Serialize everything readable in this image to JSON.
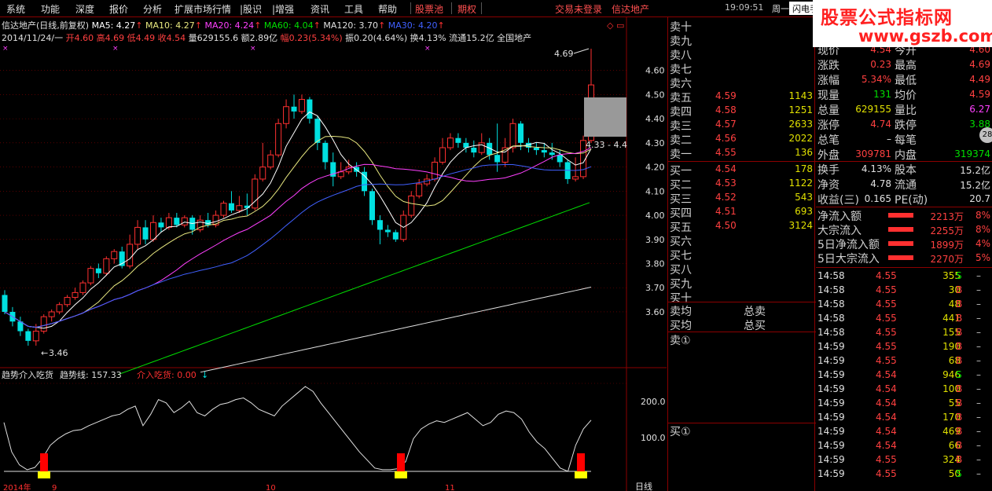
{
  "menu": {
    "items": [
      "系统",
      "功能",
      "深度",
      "报价",
      "分析",
      "扩展市场行情",
      "|股识",
      "|增强",
      "资讯",
      "工具",
      "帮助"
    ],
    "hot": [
      "股票池",
      "期权"
    ],
    "login": "交易未登录",
    "stock": "信达地产",
    "time": "19:09:51",
    "weekday": "周一",
    "flash": "闪电手"
  },
  "watermark": {
    "title": "股票公式指标网",
    "url": "www.gszb.com"
  },
  "chart": {
    "header": "信达地产(日线,前复权)",
    "ma": [
      {
        "label": "MA5: 4.27",
        "color": "#ffffff"
      },
      {
        "label": "MA10: 4.27",
        "color": "#e8e880"
      },
      {
        "label": "MA20: 4.24",
        "color": "#ff40ff"
      },
      {
        "label": "MA60: 4.04",
        "color": "#00e000"
      },
      {
        "label": "MA120: 3.70",
        "color": "#e0e0e0"
      },
      {
        "label": "MA30: 4.20",
        "color": "#4060ff"
      }
    ],
    "info_date": "2014/11/24/一",
    "info_open": "开4.60",
    "info_high": "高4.69",
    "info_low": "低4.49",
    "info_close": "收4.54",
    "info_vol": "量629155.6",
    "info_amt": "额2.89亿",
    "info_pct": "幅0.23(5.34%)",
    "info_amp": "振0.20(4.64%)",
    "info_turn": "换4.13%",
    "info_float": "流通15.2亿",
    "info_sector": "全国地产",
    "y_ticks": [
      "4.60",
      "4.50",
      "4.40",
      "4.30",
      "4.20",
      "4.10",
      "4.00",
      "3.90",
      "3.80",
      "3.70",
      "3.60"
    ],
    "high_label": "4.69",
    "low_label": "3.46",
    "range_label": "4.33 - 4.4",
    "indicator_title": "趋势介入吃货",
    "indicator_line": "趋势线: 157.33",
    "indicator_buy": "介入吃货: 0.00",
    "ind_ticks": [
      "200.0",
      "100.0"
    ],
    "x_labels": [
      "2014年",
      "9",
      "10",
      "11"
    ],
    "period": "日线"
  },
  "orderbook": {
    "sell": [
      {
        "label": "卖十",
        "price": "",
        "vol": ""
      },
      {
        "label": "卖九",
        "price": "",
        "vol": ""
      },
      {
        "label": "卖八",
        "price": "",
        "vol": ""
      },
      {
        "label": "卖七",
        "price": "",
        "vol": ""
      },
      {
        "label": "卖六",
        "price": "",
        "vol": ""
      },
      {
        "label": "卖五",
        "price": "4.59",
        "vol": "1143"
      },
      {
        "label": "卖四",
        "price": "4.58",
        "vol": "1251"
      },
      {
        "label": "卖三",
        "price": "4.57",
        "vol": "2633"
      },
      {
        "label": "卖二",
        "price": "4.56",
        "vol": "2022"
      },
      {
        "label": "卖一",
        "price": "4.55",
        "vol": "136"
      }
    ],
    "buy": [
      {
        "label": "买一",
        "price": "4.54",
        "vol": "178"
      },
      {
        "label": "买二",
        "price": "4.53",
        "vol": "1122"
      },
      {
        "label": "买三",
        "price": "4.52",
        "vol": "543"
      },
      {
        "label": "买四",
        "price": "4.51",
        "vol": "693"
      },
      {
        "label": "买五",
        "price": "4.50",
        "vol": "3124"
      },
      {
        "label": "买六",
        "price": "",
        "vol": ""
      },
      {
        "label": "买七",
        "price": "",
        "vol": ""
      },
      {
        "label": "买八",
        "price": "",
        "vol": ""
      },
      {
        "label": "买九",
        "price": "",
        "vol": ""
      },
      {
        "label": "买十",
        "price": "",
        "vol": ""
      }
    ],
    "sell_avg": "卖均",
    "buy_avg": "买均",
    "total_sell": "总卖",
    "total_buy": "总买",
    "sell_q": "卖①",
    "buy_q": "买①"
  },
  "quote": {
    "rows": [
      {
        "l1": "现价",
        "v1": "4.54",
        "c1": "red",
        "l2": "今开",
        "v2": "4.60",
        "c2": "red"
      },
      {
        "l1": "涨跌",
        "v1": "0.23",
        "c1": "red",
        "l2": "最高",
        "v2": "4.69",
        "c2": "red"
      },
      {
        "l1": "涨幅",
        "v1": "5.34%",
        "c1": "red",
        "l2": "最低",
        "v2": "4.49",
        "c2": "red"
      },
      {
        "l1": "现量",
        "v1": "131",
        "c1": "green",
        "l2": "均价",
        "v2": "4.59",
        "c2": "red"
      },
      {
        "l1": "总量",
        "v1": "629155",
        "c1": "yellow",
        "l2": "量比",
        "v2": "6.27",
        "c2": "magenta"
      },
      {
        "l1": "涨停",
        "v1": "4.74",
        "c1": "red",
        "l2": "跌停",
        "v2": "3.88",
        "c2": "green"
      },
      {
        "l1": "总笔",
        "v1": "–",
        "c1": "white",
        "l2": "每笔",
        "v2": "–",
        "c2": "white"
      },
      {
        "l1": "外盘",
        "v1": "309781",
        "c1": "red",
        "l2": "内盘",
        "v2": "319374",
        "c2": "green"
      }
    ],
    "rows2": [
      {
        "l1": "换手",
        "v1": "4.13%",
        "c1": "white",
        "l2": "股本",
        "v2": "15.2亿",
        "c2": "white"
      },
      {
        "l1": "净资",
        "v1": "4.78",
        "c1": "white",
        "l2": "流通",
        "v2": "15.2亿",
        "c2": "white"
      },
      {
        "l1": "收益(三)",
        "v1": "0.165",
        "c1": "white",
        "l2": "PE(动)",
        "v2": "20.7",
        "c2": "white"
      }
    ],
    "flows": [
      {
        "label": "净流入额",
        "value": "2213万",
        "pct": "8%"
      },
      {
        "label": "大宗流入",
        "value": "2255万",
        "pct": "8%"
      },
      {
        "label": "5日净流入额",
        "value": "1899万",
        "pct": "4%"
      },
      {
        "label": "5日大宗流入",
        "value": "2270万",
        "pct": "5%"
      }
    ],
    "badge": "28",
    "ticks": [
      {
        "time": "14:58",
        "price": "4.55",
        "vol": "355",
        "bs": "S",
        "vc": "yellow"
      },
      {
        "time": "14:58",
        "price": "4.55",
        "vol": "30",
        "bs": "B",
        "vc": "yellow"
      },
      {
        "time": "14:58",
        "price": "4.55",
        "vol": "48",
        "bs": "B",
        "vc": "yellow"
      },
      {
        "time": "14:58",
        "price": "4.55",
        "vol": "441",
        "bs": "B",
        "vc": "yellow"
      },
      {
        "time": "14:58",
        "price": "4.55",
        "vol": "155",
        "bs": "B",
        "vc": "yellow"
      },
      {
        "time": "14:59",
        "price": "4.55",
        "vol": "190",
        "bs": "B",
        "vc": "yellow"
      },
      {
        "time": "14:59",
        "price": "4.55",
        "vol": "68",
        "bs": "B",
        "vc": "yellow"
      },
      {
        "time": "14:59",
        "price": "4.54",
        "vol": "946",
        "bs": "S",
        "vc": "magenta"
      },
      {
        "time": "14:59",
        "price": "4.54",
        "vol": "100",
        "bs": "B",
        "vc": "yellow"
      },
      {
        "time": "14:59",
        "price": "4.54",
        "vol": "55",
        "bs": "B",
        "vc": "yellow"
      },
      {
        "time": "14:59",
        "price": "4.54",
        "vol": "170",
        "bs": "B",
        "vc": "yellow"
      },
      {
        "time": "14:59",
        "price": "4.54",
        "vol": "469",
        "bs": "B",
        "vc": "yellow"
      },
      {
        "time": "14:59",
        "price": "4.54",
        "vol": "66",
        "bs": "B",
        "vc": "yellow"
      },
      {
        "time": "14:59",
        "price": "4.55",
        "vol": "324",
        "bs": "B",
        "vc": "yellow"
      },
      {
        "time": "14:59",
        "price": "4.55",
        "vol": "50",
        "bs": "S",
        "vc": "yellow"
      }
    ],
    "tick_dash": "–"
  },
  "colors": {
    "up": "#ff3030",
    "down": "#00e0e0",
    "ma5": "#ffffff",
    "ma10": "#e8e880",
    "ma20": "#ff40ff",
    "ma30": "#4060ff",
    "ma60": "#00e000",
    "ma120": "#e0e0e0",
    "frame": "#8b0000"
  },
  "chart_data": {
    "type": "candlestick",
    "candles": [
      [
        3.67,
        3.6,
        3.69,
        3.59
      ],
      [
        3.6,
        3.56,
        3.62,
        3.54
      ],
      [
        3.56,
        3.52,
        3.58,
        3.5
      ],
      [
        3.52,
        3.48,
        3.53,
        3.46
      ],
      [
        3.48,
        3.52,
        3.55,
        3.46
      ],
      [
        3.52,
        3.58,
        3.59,
        3.51
      ],
      [
        3.58,
        3.6,
        3.61,
        3.56
      ],
      [
        3.6,
        3.63,
        3.64,
        3.59
      ],
      [
        3.63,
        3.66,
        3.67,
        3.62
      ],
      [
        3.66,
        3.68,
        3.7,
        3.65
      ],
      [
        3.68,
        3.72,
        3.73,
        3.67
      ],
      [
        3.72,
        3.78,
        3.79,
        3.71
      ],
      [
        3.78,
        3.76,
        3.8,
        3.74
      ],
      [
        3.76,
        3.82,
        3.83,
        3.75
      ],
      [
        3.82,
        3.85,
        3.86,
        3.8
      ],
      [
        3.85,
        3.79,
        3.87,
        3.78
      ],
      [
        3.79,
        3.88,
        3.92,
        3.78
      ],
      [
        3.88,
        3.95,
        3.98,
        3.86
      ],
      [
        3.95,
        3.9,
        3.98,
        3.88
      ],
      [
        3.9,
        3.97,
        4.0,
        3.89
      ],
      [
        3.97,
        3.95,
        3.99,
        3.93
      ],
      [
        3.95,
        3.99,
        4.01,
        3.94
      ],
      [
        3.99,
        3.96,
        4.01,
        3.95
      ],
      [
        3.96,
        3.99,
        4.0,
        3.95
      ],
      [
        3.99,
        3.94,
        4.0,
        3.92
      ],
      [
        3.94,
        3.98,
        4.0,
        3.93
      ],
      [
        3.98,
        3.96,
        4.01,
        3.95
      ],
      [
        3.96,
        4.0,
        4.02,
        3.95
      ],
      [
        4.0,
        4.05,
        4.06,
        3.99
      ],
      [
        4.05,
        4.02,
        4.1,
        4.01
      ],
      [
        4.02,
        4.04,
        4.08,
        4.01
      ],
      [
        4.04,
        4.03,
        4.09,
        4.0
      ],
      [
        4.03,
        4.15,
        4.17,
        4.02
      ],
      [
        4.15,
        4.2,
        4.3,
        4.14
      ],
      [
        4.2,
        4.25,
        4.27,
        4.19
      ],
      [
        4.25,
        4.38,
        4.4,
        4.24
      ],
      [
        4.38,
        4.45,
        4.48,
        4.36
      ],
      [
        4.45,
        4.43,
        4.5,
        4.4
      ],
      [
        4.43,
        4.48,
        4.5,
        4.42
      ],
      [
        4.48,
        4.4,
        4.49,
        4.38
      ],
      [
        4.4,
        4.3,
        4.41,
        4.27
      ],
      [
        4.3,
        4.22,
        4.31,
        4.19
      ],
      [
        4.22,
        4.16,
        4.26,
        4.12
      ],
      [
        4.16,
        4.18,
        4.22,
        4.15
      ],
      [
        4.18,
        4.2,
        4.23,
        4.17
      ],
      [
        4.2,
        4.18,
        4.22,
        4.16
      ],
      [
        4.18,
        4.1,
        4.2,
        4.08
      ],
      [
        4.1,
        3.98,
        4.11,
        3.96
      ],
      [
        3.98,
        3.94,
        4.0,
        3.88
      ],
      [
        3.94,
        3.93,
        3.96,
        3.91
      ],
      [
        3.93,
        3.9,
        3.94,
        3.89
      ],
      [
        3.9,
        4.0,
        4.02,
        3.89
      ],
      [
        4.0,
        4.08,
        4.1,
        3.99
      ],
      [
        4.08,
        4.13,
        4.15,
        4.07
      ],
      [
        4.13,
        4.15,
        4.17,
        4.12
      ],
      [
        4.15,
        4.22,
        4.24,
        4.14
      ],
      [
        4.22,
        4.28,
        4.32,
        4.21
      ],
      [
        4.28,
        4.32,
        4.34,
        4.27
      ],
      [
        4.32,
        4.3,
        4.34,
        4.28
      ],
      [
        4.3,
        4.28,
        4.32,
        4.26
      ],
      [
        4.28,
        4.26,
        4.31,
        4.24
      ],
      [
        4.26,
        4.3,
        4.34,
        4.25
      ],
      [
        4.3,
        4.25,
        4.32,
        4.23
      ],
      [
        4.25,
        4.22,
        4.38,
        4.18
      ],
      [
        4.22,
        4.28,
        4.32,
        4.2
      ],
      [
        4.28,
        4.38,
        4.4,
        4.26
      ],
      [
        4.38,
        4.3,
        4.39,
        4.27
      ],
      [
        4.3,
        4.28,
        4.32,
        4.26
      ],
      [
        4.28,
        4.27,
        4.3,
        4.25
      ],
      [
        4.27,
        4.26,
        4.3,
        4.24
      ],
      [
        4.26,
        4.25,
        4.3,
        4.23
      ],
      [
        4.25,
        4.22,
        4.27,
        4.2
      ],
      [
        4.22,
        4.15,
        4.23,
        4.13
      ],
      [
        4.15,
        4.16,
        4.24,
        4.14
      ],
      [
        4.16,
        4.31,
        4.33,
        4.15
      ],
      [
        4.31,
        4.54,
        4.69,
        4.3
      ]
    ],
    "ylim": [
      3.46,
      4.69
    ],
    "ind_line": [
      150,
      60,
      20,
      5,
      12,
      40,
      80,
      100,
      115,
      125,
      128,
      140,
      150,
      160,
      170,
      175,
      190,
      200,
      140,
      175,
      220,
      210,
      180,
      195,
      215,
      180,
      170,
      190,
      205,
      210,
      220,
      225,
      210,
      190,
      180,
      170,
      200,
      220,
      240,
      260,
      245,
      210,
      180,
      150,
      120,
      90,
      60,
      35,
      10,
      5,
      5,
      8,
      30,
      100,
      130,
      145,
      155,
      150,
      160,
      170,
      180,
      160,
      140,
      150,
      175,
      185,
      180,
      160,
      120,
      90,
      70,
      40,
      10,
      0,
      80,
      130,
      157
    ]
  }
}
